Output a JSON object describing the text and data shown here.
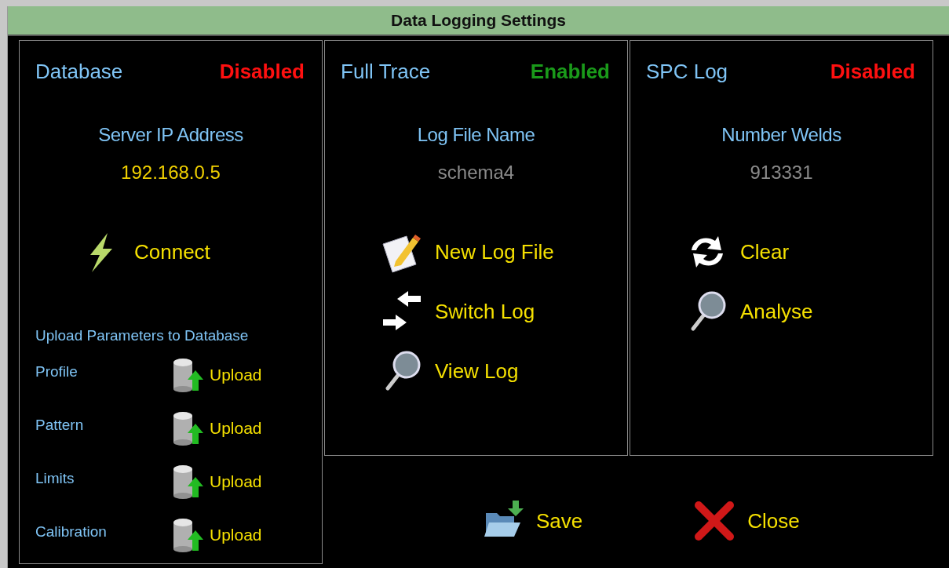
{
  "window": {
    "title": "Data Logging Settings"
  },
  "database": {
    "title": "Database",
    "status": "Disabled",
    "enabled": false,
    "field_label": "Server IP Address",
    "field_value": "192.168.0.5",
    "actions": [
      "Connect"
    ],
    "upload_heading": "Upload Parameters to Database",
    "uploads": [
      {
        "label": "Profile",
        "button": "Upload"
      },
      {
        "label": "Pattern",
        "button": "Upload"
      },
      {
        "label": "Limits",
        "button": "Upload"
      },
      {
        "label": "Calibration",
        "button": "Upload"
      }
    ]
  },
  "full_trace": {
    "title": "Full Trace",
    "status": "Enabled",
    "enabled": true,
    "field_label": "Log File Name",
    "field_value": "schema4",
    "actions": [
      "New Log File",
      "Switch Log",
      "View Log"
    ]
  },
  "spc_log": {
    "title": "SPC Log",
    "status": "Disabled",
    "enabled": false,
    "field_label": "Number Welds",
    "field_value": "913331",
    "actions": [
      "Clear",
      "Analyse"
    ]
  },
  "buttons": [
    "Save",
    "Close"
  ]
}
